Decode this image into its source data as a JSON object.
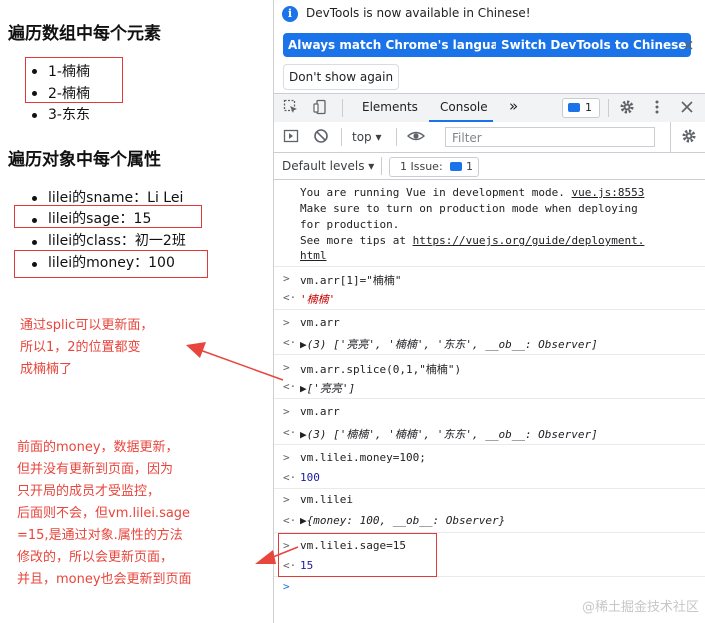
{
  "page": {
    "section1_title": "遍历数组中每个元素",
    "array_items": [
      "1-楠楠",
      "2-楠楠",
      "3-东东"
    ],
    "section2_title": "遍历对象中每个属性",
    "object_items": [
      "lilei的sname：Li Lei",
      "lilei的sage：15",
      "lilei的class：初一2班",
      "lilei的money：100"
    ]
  },
  "notes": {
    "note1": [
      "通过splic可以更新面，",
      "所以1，2的位置都变",
      "成楠楠了"
    ],
    "note2": [
      "前面的money，数据更新，",
      "但并没有更新到页面，因为",
      "只开局的成员才受监控，",
      "后面则不会，但vm.lilei.sage",
      "=15,是通过对象.属性的方法",
      "修改的，所以会更新页面，",
      "并且，money也会更新到页面"
    ]
  },
  "devtools": {
    "info_text": "DevTools is now available in Chinese!",
    "btn_match": "Always match Chrome's language",
    "btn_switch": "Switch DevTools to Chinese",
    "btn_dont_show": "Don't show again",
    "close_glyph": "×",
    "tab_elements": "Elements",
    "tab_console": "Console",
    "tab_more": "»",
    "badge_count": "1",
    "context": "top ▾",
    "filter_placeholder": "Filter",
    "default_levels": "Default levels ▾",
    "issue_label": "1 Issue:",
    "issue_count": "1",
    "colors": {
      "accent": "#1a73e8",
      "annotation": "#e8453c"
    }
  },
  "console": {
    "vue_msg": [
      "You are running Vue in development mode.",
      "Make sure to turn on production mode when deploying",
      "for production.",
      "See more tips at "
    ],
    "vue_link": "vue.js:8553",
    "tips_link": "https://vuejs.org/guide/deployment.",
    "tips_link2": "html",
    "cmd1": "vm.arr[1]=\"楠楠\"",
    "res1": "'楠楠'",
    "cmd2": "vm.arr",
    "res2": "▶(3) ['亮亮', '楠楠', '东东', __ob__: Observer]",
    "cmd3": "vm.arr.splice(0,1,\"楠楠\")",
    "res3": "▶['亮亮']",
    "cmd4": "vm.arr",
    "res4": "▶(3) ['楠楠', '楠楠', '东东', __ob__: Observer]",
    "cmd5": "vm.lilei.money=100;",
    "res5": "100",
    "cmd6": "vm.lilei",
    "res6": "▶{money: 100, __ob__: Observer}",
    "cmd7": "vm.lilei.sage=15",
    "res7": "15"
  },
  "watermark": "@稀土掘金技术社区"
}
